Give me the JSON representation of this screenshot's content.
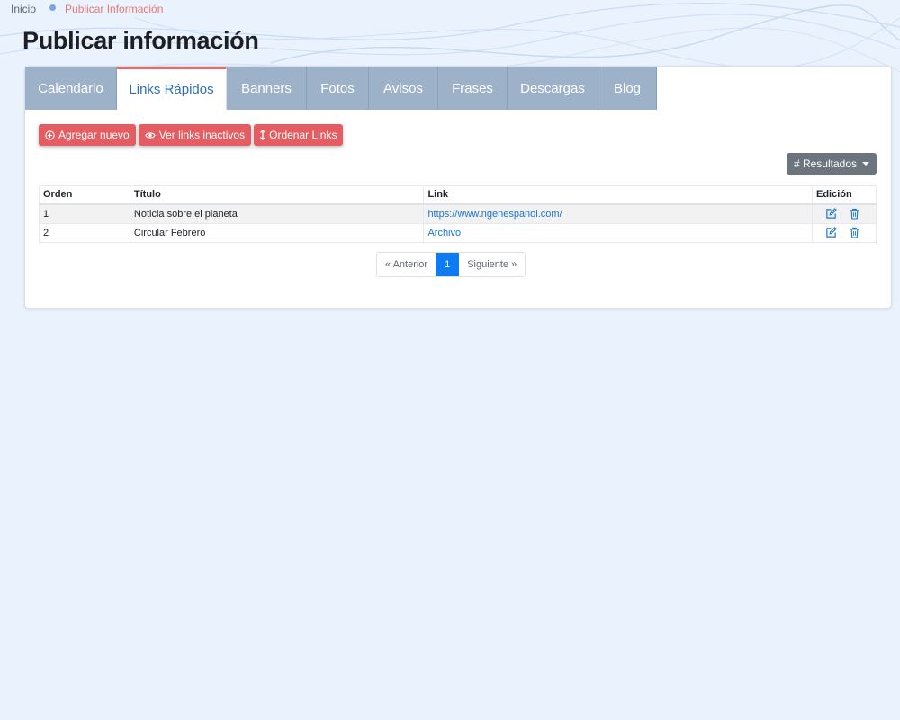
{
  "breadcrumb": {
    "home": "Inicio",
    "current": "Publicar Información"
  },
  "page_title": "Publicar información",
  "tabs": [
    {
      "label": "Calendario",
      "active": false
    },
    {
      "label": "Links Rápidos",
      "active": true
    },
    {
      "label": "Banners",
      "active": false
    },
    {
      "label": "Fotos",
      "active": false
    },
    {
      "label": "Avisos",
      "active": false
    },
    {
      "label": "Frases",
      "active": false
    },
    {
      "label": "Descargas",
      "active": false
    },
    {
      "label": "Blog",
      "active": false
    }
  ],
  "actions": {
    "add": {
      "label": "Agregar nuevo",
      "icon": "plus-circle-icon"
    },
    "inactive": {
      "label": "Ver links inactivos",
      "icon": "eye-icon"
    },
    "order": {
      "label": "Ordenar Links",
      "icon": "sort-arrows-icon"
    }
  },
  "results_dropdown": {
    "label": "# Resultados"
  },
  "table": {
    "headers": {
      "orden": "Orden",
      "titulo": "Título",
      "link": "Link",
      "edicion": "Edición"
    },
    "rows": [
      {
        "orden": "1",
        "titulo": "Noticia sobre el planeta",
        "link": "https://www.ngenespanol.com/"
      },
      {
        "orden": "2",
        "titulo": "Circular Febrero",
        "link": "Archivo"
      }
    ]
  },
  "pagination": {
    "prev": "« Anterior",
    "current": "1",
    "next": "Siguiente »"
  },
  "colors": {
    "accent_red": "#e35d62",
    "tab_inactive": "#9db1c8",
    "link_blue": "#1976d2",
    "page_active": "#0d7bf2",
    "background": "#eaf2fd"
  }
}
